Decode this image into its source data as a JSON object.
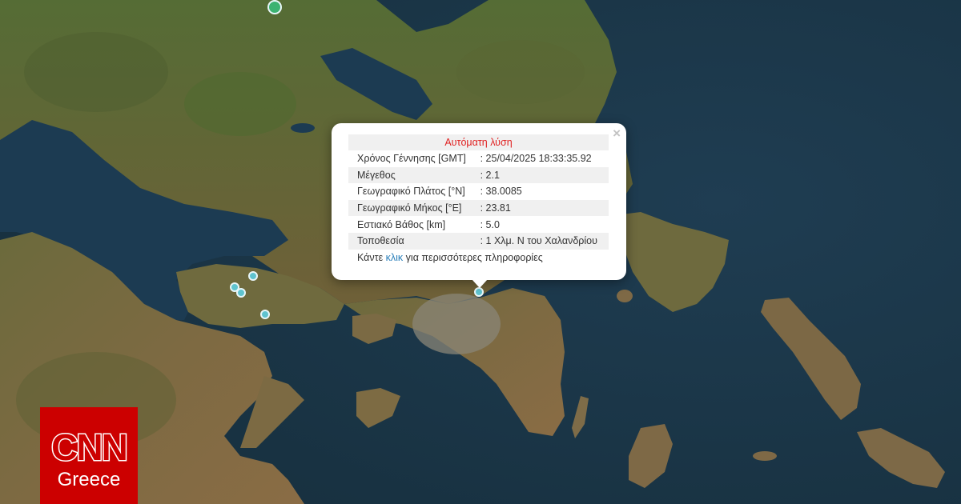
{
  "popup": {
    "title": "Αυτόματη λύση",
    "close_label": "×",
    "rows": [
      {
        "label": "Χρόνος Γέννησης [GMT]",
        "value": ": 25/04/2025 18:33:35.92"
      },
      {
        "label": "Μέγεθος",
        "value": ": 2.1"
      },
      {
        "label": "Γεωγραφικό Πλάτος [°N]",
        "value": ": 38.0085"
      },
      {
        "label": "Γεωγραφικό Μήκος [°E]",
        "value": ": 23.81"
      },
      {
        "label": "Εστιακό Βάθος [km]",
        "value": ": 5.0"
      },
      {
        "label": "Τοποθεσία",
        "value": ": 1 Χλμ. Ν του Χαλανδρίου"
      }
    ],
    "more_prefix": "Κάντε ",
    "more_link": "κλικ",
    "more_suffix": " για περισσότερες πληροφορίες"
  },
  "markers": {
    "event_color": "#5fc3cf",
    "recent_color": "#3cb371"
  },
  "logo": {
    "brand": "CNN",
    "edition": "Greece",
    "color": "#cc0000"
  },
  "colors": {
    "sea": "#1d3a4f",
    "land": "#7a6a40"
  }
}
